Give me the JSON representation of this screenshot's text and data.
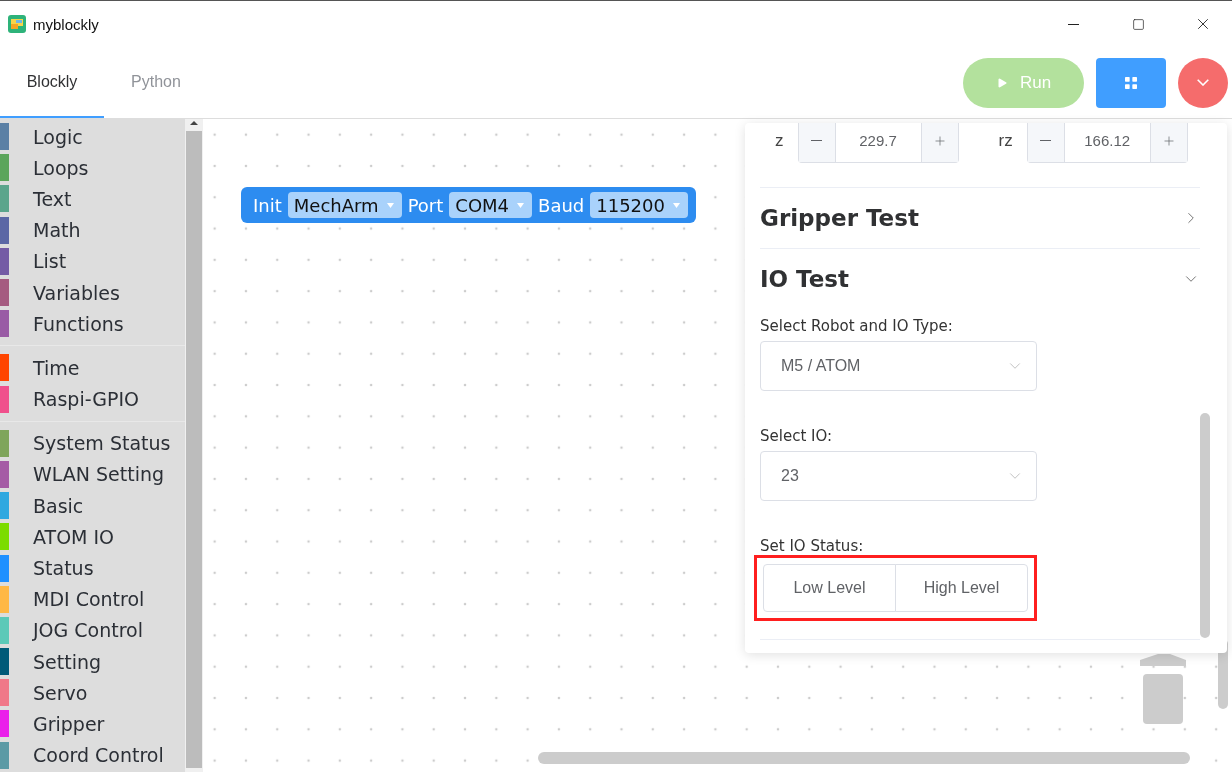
{
  "window": {
    "title": "myblockly"
  },
  "tabs": [
    {
      "label": "Blockly",
      "selected": true
    },
    {
      "label": "Python",
      "selected": false
    }
  ],
  "toolbar": {
    "run": {
      "label": "Run",
      "disabled": true
    }
  },
  "toolbox": {
    "groups": [
      {
        "items": [
          {
            "label": "Logic",
            "color": "#5b80a5"
          },
          {
            "label": "Loops",
            "color": "#5ba55b"
          },
          {
            "label": "Text",
            "color": "#5ba58c"
          },
          {
            "label": "Math",
            "color": "#5b67a5"
          },
          {
            "label": "List",
            "color": "#745ba5"
          },
          {
            "label": "Variables",
            "color": "#a55b80"
          },
          {
            "label": "Functions",
            "color": "#995ba5"
          }
        ]
      },
      {
        "items": [
          {
            "label": "Time",
            "color": "#ff4500"
          },
          {
            "label": "Raspi-GPIO",
            "color": "#f0508c"
          }
        ]
      },
      {
        "items": [
          {
            "label": "System Status",
            "color": "#7fa55b"
          },
          {
            "label": "WLAN Setting",
            "color": "#a55ba5"
          },
          {
            "label": "Basic",
            "color": "#2fa8e0"
          },
          {
            "label": "ATOM IO",
            "color": "#7cdc00"
          },
          {
            "label": "Status",
            "color": "#1e90ff"
          },
          {
            "label": "MDI Control",
            "color": "#ffb845"
          },
          {
            "label": "JOG Control",
            "color": "#5cc9b8"
          },
          {
            "label": "Setting",
            "color": "#005a78"
          },
          {
            "label": "Servo",
            "color": "#f07888"
          },
          {
            "label": "Gripper",
            "color": "#ea20ea"
          },
          {
            "label": "Coord Control",
            "color": "#5b9aa5"
          }
        ]
      }
    ]
  },
  "block": {
    "parts": [
      {
        "kind": "label",
        "text": "Init"
      },
      {
        "kind": "dropdown",
        "text": "MechArm"
      },
      {
        "kind": "label",
        "text": "Port"
      },
      {
        "kind": "dropdown",
        "text": "COM4"
      },
      {
        "kind": "label",
        "text": "Baud"
      },
      {
        "kind": "dropdown",
        "text": "115200"
      }
    ]
  },
  "panel": {
    "coords": [
      {
        "label": "z",
        "value": "229.7"
      },
      {
        "label": "rz",
        "value": "166.12"
      }
    ],
    "sections": [
      {
        "title": "Gripper Test",
        "expanded": false
      },
      {
        "title": "IO Test",
        "expanded": true,
        "selects": [
          {
            "label": "Select Robot and IO Type:",
            "value": "M5 / ATOM"
          },
          {
            "label": "Select IO:",
            "value": "23"
          }
        ],
        "status": {
          "label": "Set IO Status:",
          "highlighted": true,
          "buttons": [
            "Low Level",
            "High Level"
          ]
        }
      }
    ]
  }
}
